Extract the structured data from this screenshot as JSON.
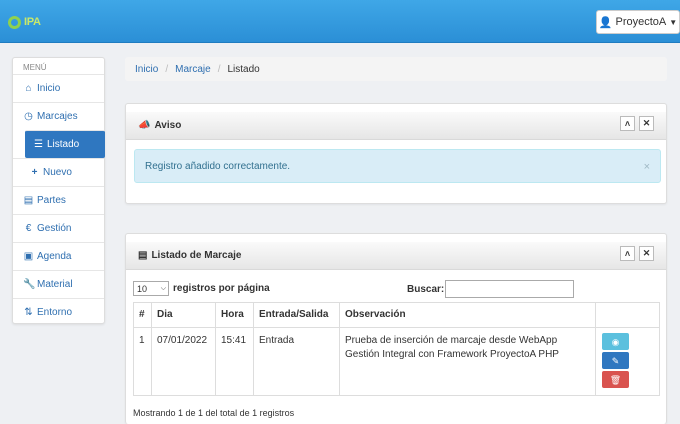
{
  "header": {
    "logo_text": "IPA",
    "user_label": "ProyectoA"
  },
  "sidebar": {
    "title": "MENÚ",
    "items": [
      {
        "label": "Inicio"
      },
      {
        "label": "Marcajes"
      },
      {
        "label": "Listado"
      },
      {
        "label": "Nuevo"
      },
      {
        "label": "Partes"
      },
      {
        "label": "Gestión"
      },
      {
        "label": "Agenda"
      },
      {
        "label": "Material"
      },
      {
        "label": "Entorno"
      }
    ]
  },
  "breadcrumb": {
    "items": [
      "Inicio",
      "Marcaje",
      "Listado"
    ]
  },
  "aviso": {
    "title": "Aviso",
    "message": "Registro añadido correctamente.",
    "close": "×"
  },
  "listado": {
    "title": "Listado de Marcaje",
    "page_size": "10",
    "page_size_label": "registros por página",
    "search_label": "Buscar:",
    "columns": [
      "#",
      "Dia",
      "Hora",
      "Entrada/Salida",
      "Observación",
      ""
    ],
    "rows": [
      {
        "num": "1",
        "dia": "07/01/2022",
        "hora": "15:41",
        "tipo": "Entrada",
        "obs": "Prueba de inserción de marcaje desde WebApp Gestión Integral con Framework ProyectoA PHP"
      }
    ],
    "info": "Mostrando 1 de 1 del total de 1 registros"
  },
  "colors": {
    "primary": "#2f77c0",
    "info": "#5bc0de",
    "danger": "#d9534f"
  }
}
